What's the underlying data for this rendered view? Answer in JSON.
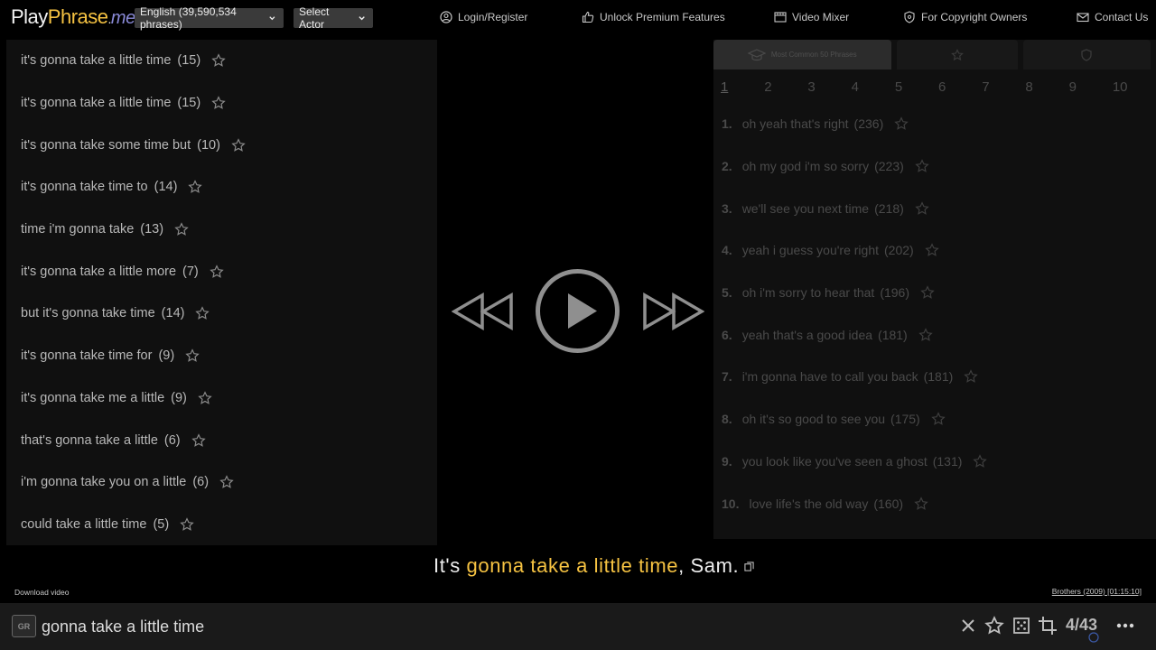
{
  "logo": {
    "w1": "Play",
    "w2": "Phrase",
    "dot": ".",
    "me": "me"
  },
  "language_select": {
    "label": "English (39,590,534 phrases)"
  },
  "actor_select": {
    "label": "Select Actor"
  },
  "nav": {
    "login": "Login/Register",
    "premium": "Unlock Premium Features",
    "mixer": "Video Mixer",
    "copyright": "For Copyright Owners",
    "contact": "Contact Us"
  },
  "left_list": [
    {
      "phrase": "it's gonna take a little time",
      "count": "(15)"
    },
    {
      "phrase": "it's gonna take a little time",
      "count": "(15)"
    },
    {
      "phrase": "it's gonna take some time but",
      "count": "(10)"
    },
    {
      "phrase": "it's gonna take time to",
      "count": "(14)"
    },
    {
      "phrase": "time i'm gonna take",
      "count": "(13)"
    },
    {
      "phrase": "it's gonna take a little more",
      "count": "(7)"
    },
    {
      "phrase": "but it's gonna take time",
      "count": "(14)"
    },
    {
      "phrase": "it's gonna take time for",
      "count": "(9)"
    },
    {
      "phrase": "it's gonna take me a little",
      "count": "(9)"
    },
    {
      "phrase": "that's gonna take a little",
      "count": "(6)"
    },
    {
      "phrase": "i'm gonna take you on a little",
      "count": "(6)"
    },
    {
      "phrase": "could take a little time",
      "count": "(5)"
    }
  ],
  "right_panel": {
    "tabs": [
      "Most Common 50 Phrases",
      "",
      ""
    ],
    "pages": [
      "1",
      "2",
      "3",
      "4",
      "5",
      "6",
      "7",
      "8",
      "9",
      "10"
    ],
    "rows": [
      {
        "num": "1.",
        "phrase": "oh yeah that's right",
        "count": "(236)"
      },
      {
        "num": "2.",
        "phrase": "oh my god i'm so sorry",
        "count": "(223)"
      },
      {
        "num": "3.",
        "phrase": "we'll see you next time",
        "count": "(218)"
      },
      {
        "num": "4.",
        "phrase": "yeah i guess you're right",
        "count": "(202)"
      },
      {
        "num": "5.",
        "phrase": "oh i'm sorry to hear that",
        "count": "(196)"
      },
      {
        "num": "6.",
        "phrase": "yeah that's a good idea",
        "count": "(181)"
      },
      {
        "num": "7.",
        "phrase": "i'm gonna have to call you back",
        "count": "(181)"
      },
      {
        "num": "8.",
        "phrase": "oh it's so good to see you",
        "count": "(175)"
      },
      {
        "num": "9.",
        "phrase": "you look like you've seen a ghost",
        "count": "(131)"
      },
      {
        "num": "10.",
        "phrase": "love life's the old way",
        "count": "(160)"
      }
    ]
  },
  "subtitle": {
    "pre": "It's ",
    "highlight": "gonna take a little time",
    "post": ", Sam."
  },
  "download_label": "Download video",
  "movie_ref": "Brothers (2009) [01:15:10]",
  "search": {
    "gr_label": "GR",
    "value": "gonna take a little time",
    "counter": "4/43"
  },
  "colors": {
    "accent": "#f5c242",
    "background": "#000000",
    "panel": "#101010",
    "bar": "#1a1a1a"
  }
}
